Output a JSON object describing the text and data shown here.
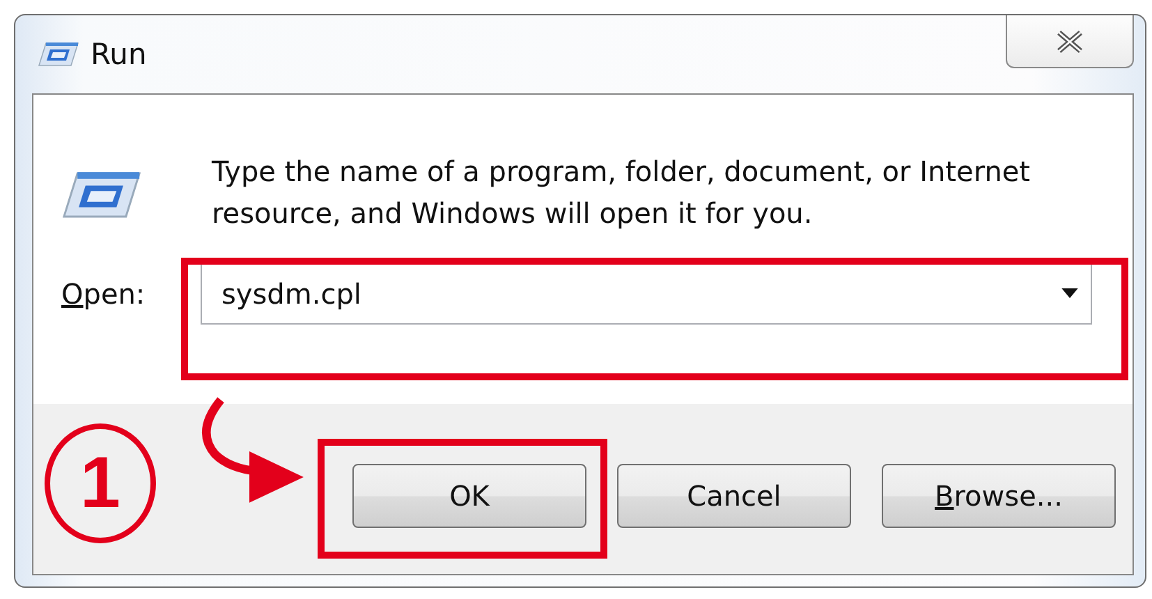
{
  "window": {
    "title": "Run"
  },
  "message": "Type the name of a program, folder, document, or Internet resource, and Windows will open it for you.",
  "open_field": {
    "label_mnemonic": "O",
    "label_rest": "pen:",
    "value": "sysdm.cpl"
  },
  "buttons": [
    {
      "kind": "plain",
      "label": "OK"
    },
    {
      "kind": "plain",
      "label": "Cancel"
    },
    {
      "kind": "mnemonic",
      "mnemonic": "B",
      "rest": "rowse..."
    }
  ],
  "annotations": [
    {
      "kind": "fieldframe"
    },
    {
      "kind": "buttonframe"
    },
    {
      "kind": "step",
      "label": "1"
    },
    {
      "kind": "arrow"
    }
  ]
}
